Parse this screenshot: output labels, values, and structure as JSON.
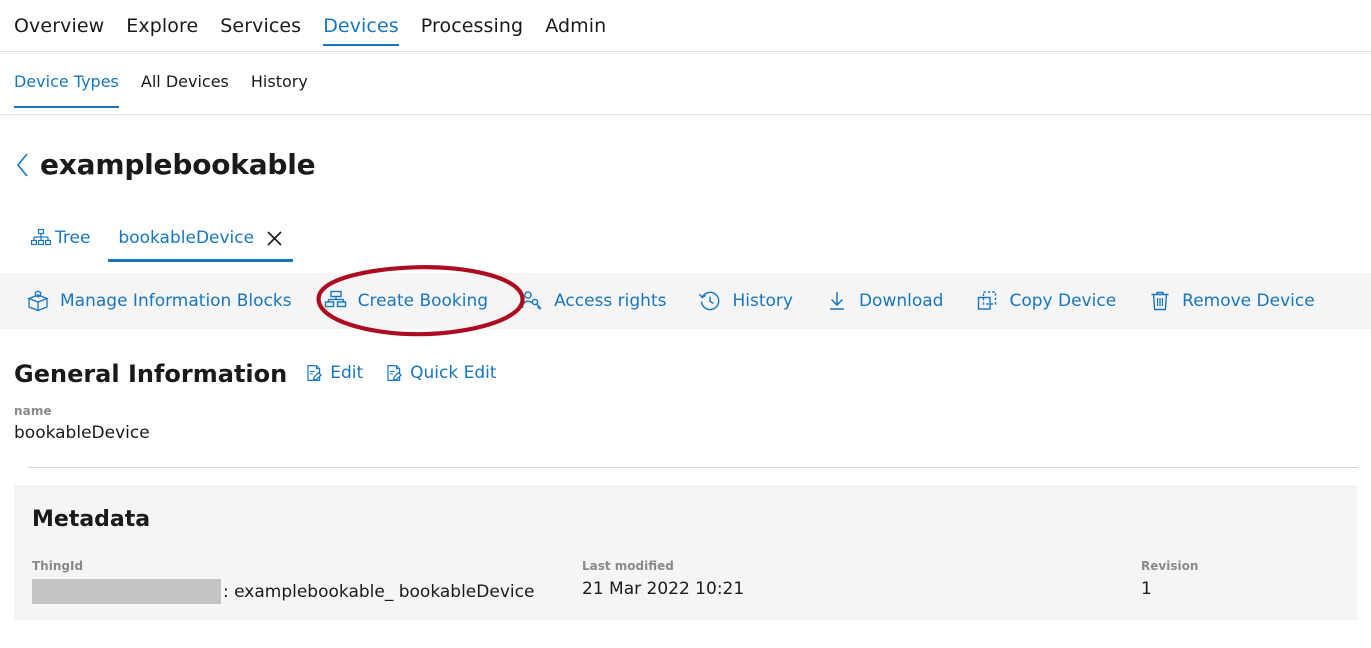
{
  "colors": {
    "accent_blue": "#1776bf",
    "text_dark": "#1a1a1a",
    "label_gray": "#8a8a8a",
    "panel_gray": "#f5f5f5",
    "redaction_gray": "#c4c4c4",
    "annotation_red": "#ad0b20"
  },
  "topnav": {
    "items": [
      {
        "label": "Overview",
        "active": false
      },
      {
        "label": "Explore",
        "active": false
      },
      {
        "label": "Services",
        "active": false
      },
      {
        "label": "Devices",
        "active": true
      },
      {
        "label": "Processing",
        "active": false
      },
      {
        "label": "Admin",
        "active": false
      }
    ]
  },
  "subnav": {
    "items": [
      {
        "label": "Device Types",
        "active": true
      },
      {
        "label": "All Devices",
        "active": false
      },
      {
        "label": "History",
        "active": false
      }
    ]
  },
  "page": {
    "back_icon": "chevron-left-icon",
    "title": "examplebookable"
  },
  "device_tabs": {
    "tree": {
      "label": "Tree",
      "icon": "hierarchy-icon"
    },
    "active_tab": {
      "label": "bookableDevice",
      "close_icon": "close-icon"
    }
  },
  "toolbar": {
    "actions": [
      {
        "label": "Manage Information Blocks",
        "icon": "box-gear-icon"
      },
      {
        "label": "Create Booking",
        "icon": "layout-blocks-icon"
      },
      {
        "label": "Access rights",
        "icon": "person-key-icon"
      },
      {
        "label": "History",
        "icon": "clock-history-icon"
      },
      {
        "label": "Download",
        "icon": "download-icon"
      },
      {
        "label": "Copy Device",
        "icon": "copy-icon"
      },
      {
        "label": "Remove Device",
        "icon": "trash-icon"
      }
    ]
  },
  "general_information": {
    "title": "General Information",
    "links": [
      {
        "label": "Edit",
        "icon": "edit-document-icon"
      },
      {
        "label": "Quick Edit",
        "icon": "edit-document-icon"
      }
    ],
    "fields": [
      {
        "label": "name",
        "value": "bookableDevice"
      }
    ]
  },
  "metadata": {
    "title": "Metadata",
    "columns": [
      {
        "label": "ThingId",
        "value": ": examplebookable_ bookableDevice",
        "redacted_prefix": true
      },
      {
        "label": "Last modified",
        "value": "21 Mar 2022 10:21",
        "redacted_prefix": false
      },
      {
        "label": "Revision",
        "value": "1",
        "redacted_prefix": false
      }
    ]
  },
  "annotation": {
    "shape": "ellipse",
    "target": "Create Booking",
    "color": "#ad0b20"
  }
}
